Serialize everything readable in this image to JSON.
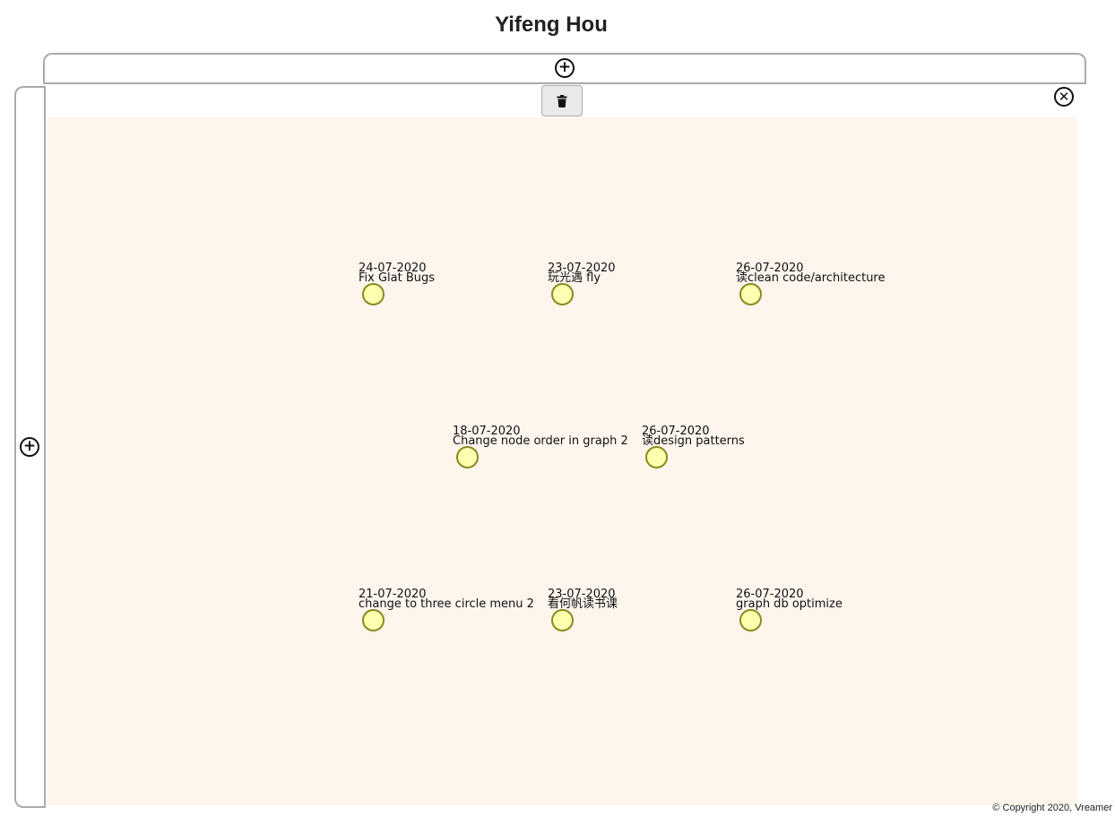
{
  "header": {
    "title": "Yifeng Hou"
  },
  "toolbar": {
    "add_top_icon": "plus-circle-icon",
    "add_side_icon": "plus-circle-icon",
    "delete_icon": "trash-icon",
    "close_icon": "x-circle-icon",
    "add_glyph": "+",
    "close_glyph": "✕"
  },
  "canvas": {
    "background_color": "#fef5ed",
    "node_fill_color": "#ffffb0",
    "node_stroke_color": "#8a8a1e",
    "nodes": [
      {
        "date": "24-07-2020",
        "label": "Fix Glat Bugs"
      },
      {
        "date": "23-07-2020",
        "label": "玩光遇 fly"
      },
      {
        "date": "26-07-2020",
        "label": "读clean code/architecture"
      },
      {
        "date": "18-07-2020",
        "label": "Change node order in graph 2"
      },
      {
        "date": "26-07-2020",
        "label": "读design patterns"
      },
      {
        "date": "21-07-2020",
        "label": "change to three circle menu 2"
      },
      {
        "date": "23-07-2020",
        "label": "看何帆读书课"
      },
      {
        "date": "26-07-2020",
        "label": "graph db optimize"
      }
    ]
  },
  "footer": {
    "copyright": "© Copyright 2020, Vreamer"
  }
}
